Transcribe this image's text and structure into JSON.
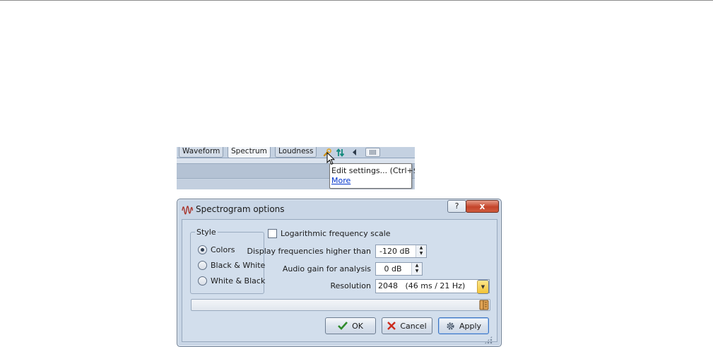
{
  "tabs": {
    "items": [
      {
        "label": "Waveform",
        "active": false
      },
      {
        "label": "Spectrum",
        "active": true
      },
      {
        "label": "Loudness",
        "active": false
      }
    ],
    "icons": [
      "wrench-icon",
      "swap-arrows-icon",
      "scroll-left-icon",
      "scroll-thumb-icon"
    ]
  },
  "tooltip": {
    "text": "Edit settings... (Ctrl+$)",
    "link": "More"
  },
  "dialog": {
    "title": "Spectrogram options",
    "help_label": "?",
    "close_label": "x",
    "style_group": {
      "legend": "Style",
      "options": [
        {
          "label": "Colors",
          "checked": true
        },
        {
          "label": "Black & White",
          "checked": false
        },
        {
          "label": "White & Black",
          "checked": false
        }
      ]
    },
    "log_scale": {
      "label": "Logarithmic frequency scale",
      "checked": false
    },
    "display_freq": {
      "label": "Display frequencies higher than",
      "value": "-120 dB"
    },
    "audio_gain": {
      "label": "Audio gain for analysis",
      "value": "0 dB"
    },
    "resolution": {
      "label": "Resolution",
      "value": "2048   (46 ms / 21 Hz)"
    },
    "progress": {
      "fraction": 0
    },
    "buttons": {
      "ok": "OK",
      "cancel": "Cancel",
      "apply": "Apply"
    }
  },
  "colors": {
    "accent": "#3b73c2",
    "close_button": "#c4442a",
    "link": "#0033cc",
    "combo_button": "#f2c336"
  }
}
